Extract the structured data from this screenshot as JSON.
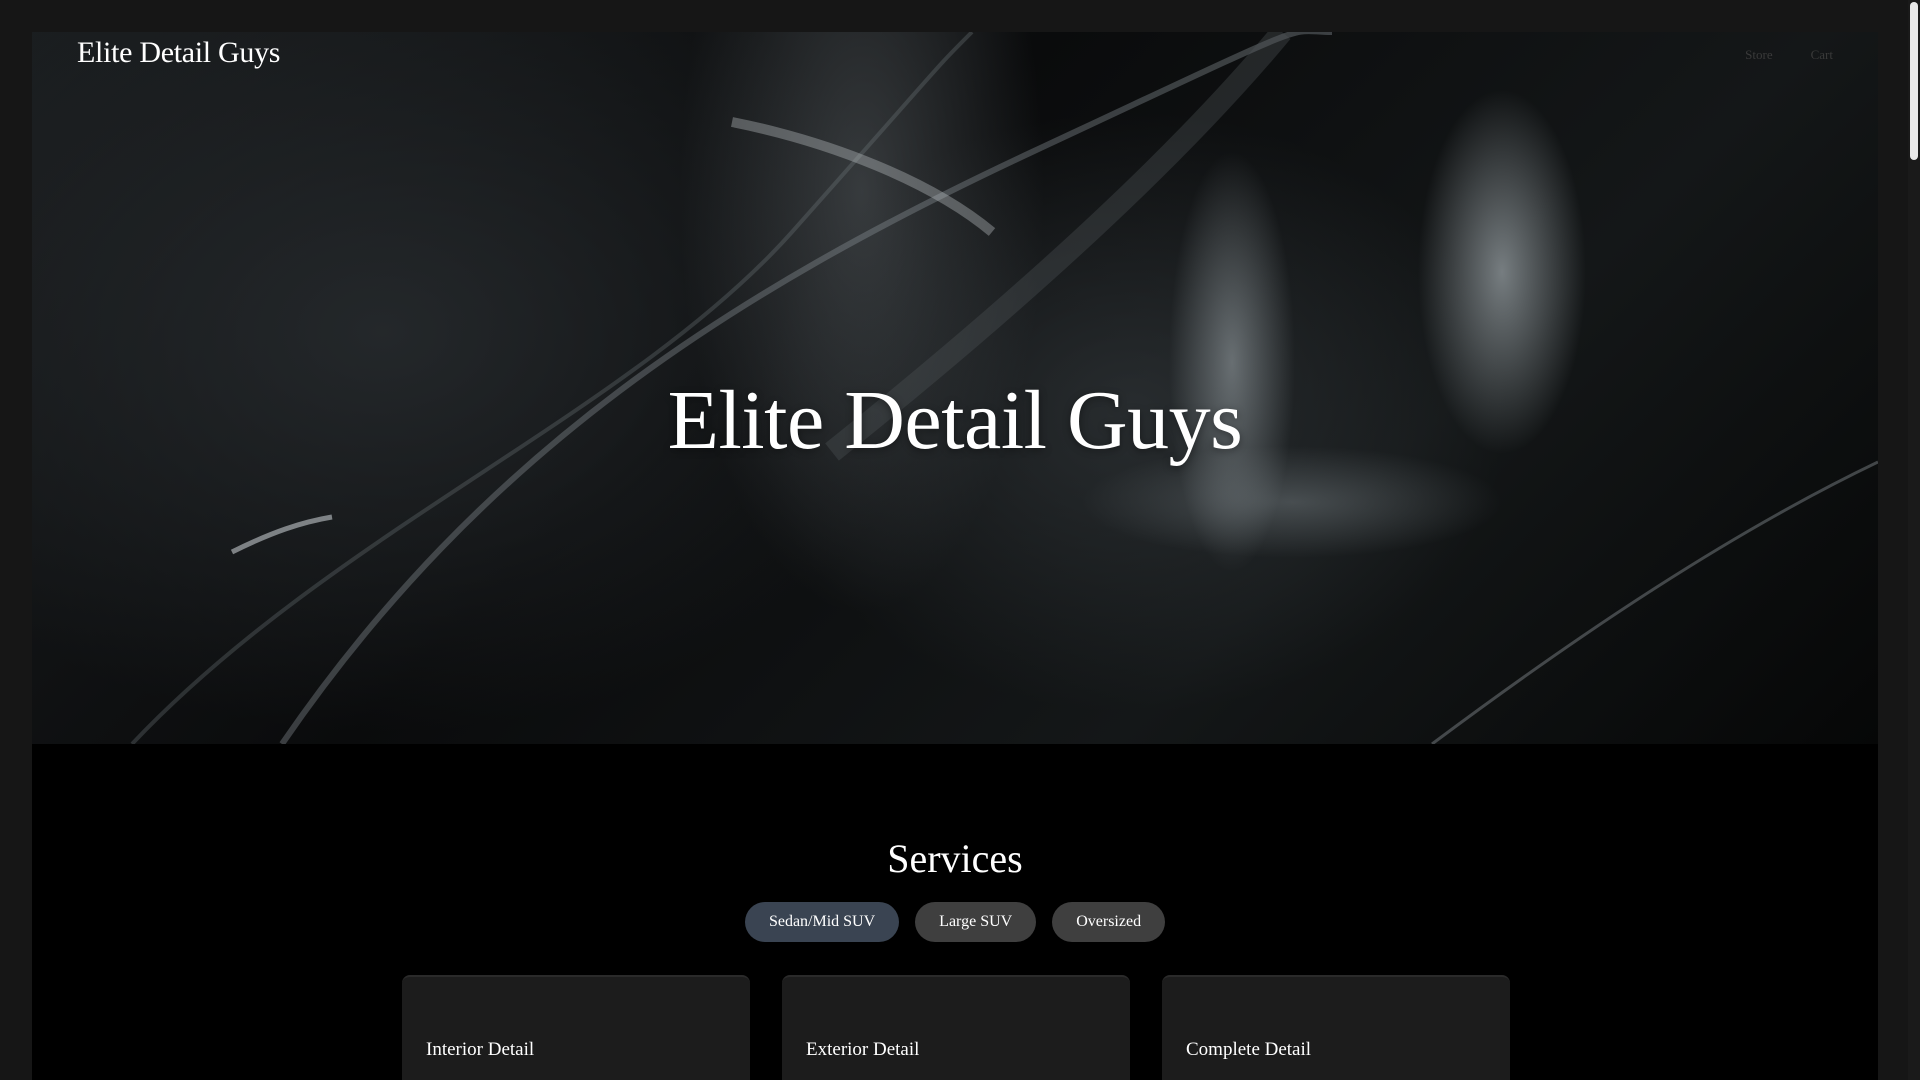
{
  "header": {
    "brand": "Elite Detail Guys",
    "nav": [
      {
        "label": "Store"
      },
      {
        "label": "Cart"
      }
    ]
  },
  "hero": {
    "title": "Elite Detail Guys"
  },
  "services": {
    "title": "Services",
    "tabs": [
      {
        "label": "Sedan/Mid SUV",
        "active": true
      },
      {
        "label": "Large SUV",
        "active": false
      },
      {
        "label": "Oversized",
        "active": false
      }
    ],
    "cards": [
      {
        "title": "Interior Detail"
      },
      {
        "title": "Exterior Detail"
      },
      {
        "title": "Complete Detail"
      }
    ]
  },
  "colors": {
    "page_background": "#000000",
    "outer_background": "#161616",
    "active_tab": "#3a4452",
    "inactive_tab": "#3f3f3f",
    "card_background": "#1c1c1c"
  }
}
